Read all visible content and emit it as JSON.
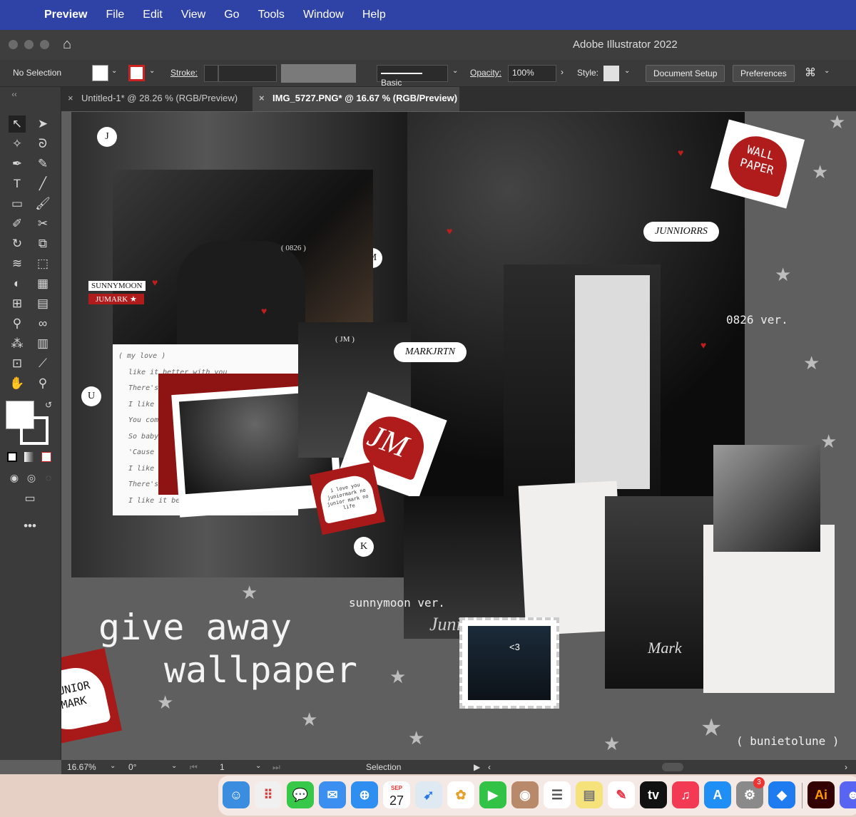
{
  "menubar": {
    "app_name": "Preview",
    "items": [
      "File",
      "Edit",
      "View",
      "Go",
      "Tools",
      "Window",
      "Help"
    ]
  },
  "window": {
    "title": "Adobe Illustrator 2022"
  },
  "controlbar": {
    "selection": "No Selection",
    "stroke_label": "Stroke:",
    "brush": "Basic",
    "opacity_label": "Opacity:",
    "opacity_value": "100%",
    "style_label": "Style:",
    "document_setup": "Document Setup",
    "preferences": "Preferences"
  },
  "tabs": [
    {
      "label": "Untitled-1* @ 28.26 % (RGB/Preview)",
      "active": false
    },
    {
      "label": "IMG_5727.PNG* @ 16.67 % (RGB/Preview)",
      "active": true
    }
  ],
  "artwork": {
    "letters": [
      "J",
      "M",
      "U",
      "K"
    ],
    "date_tag": "( 0826 )",
    "jm_tag": "( JM )",
    "sunnymoon_label": "SUNNYMOON",
    "jumark_label": "JUMARK ★",
    "lyrics": [
      "( my love )",
      "like it better with you",
      "There's",
      "I like",
      "You come",
      "So baby",
      "'Cause",
      "I like",
      "There's",
      "I like it bett"
    ],
    "jm_sticker": "JM",
    "heart_note": "i love you juniormark no junior mark no life",
    "bubble_markjrtn": "MARKJRTN",
    "bubble_junniorrs": "JUNNIORRS",
    "wall_paper": "WALL PAPER",
    "version_0826": "0826 ver.",
    "version_sunnymoon": "sunnymoon ver.",
    "give_away_line1": "give away",
    "give_away_line2": "wallpaper",
    "junior_mark": "JUNIOR MARK",
    "credit": "( bunietolune )",
    "thumb_caption": "<3",
    "script_junior": "Junior",
    "script_mark": "Mark"
  },
  "statusbar": {
    "zoom": "16.67%",
    "rotation": "0°",
    "artboard": "1",
    "mode": "Selection"
  },
  "dock": {
    "calendar_month": "SEP",
    "calendar_day": "27",
    "settings_badge": "3",
    "ai_label": "Ai"
  },
  "colors": {
    "menubar": "#2f43a6",
    "heart_red": "#b01c1c",
    "canvas_gray": "#5f5f5f"
  }
}
